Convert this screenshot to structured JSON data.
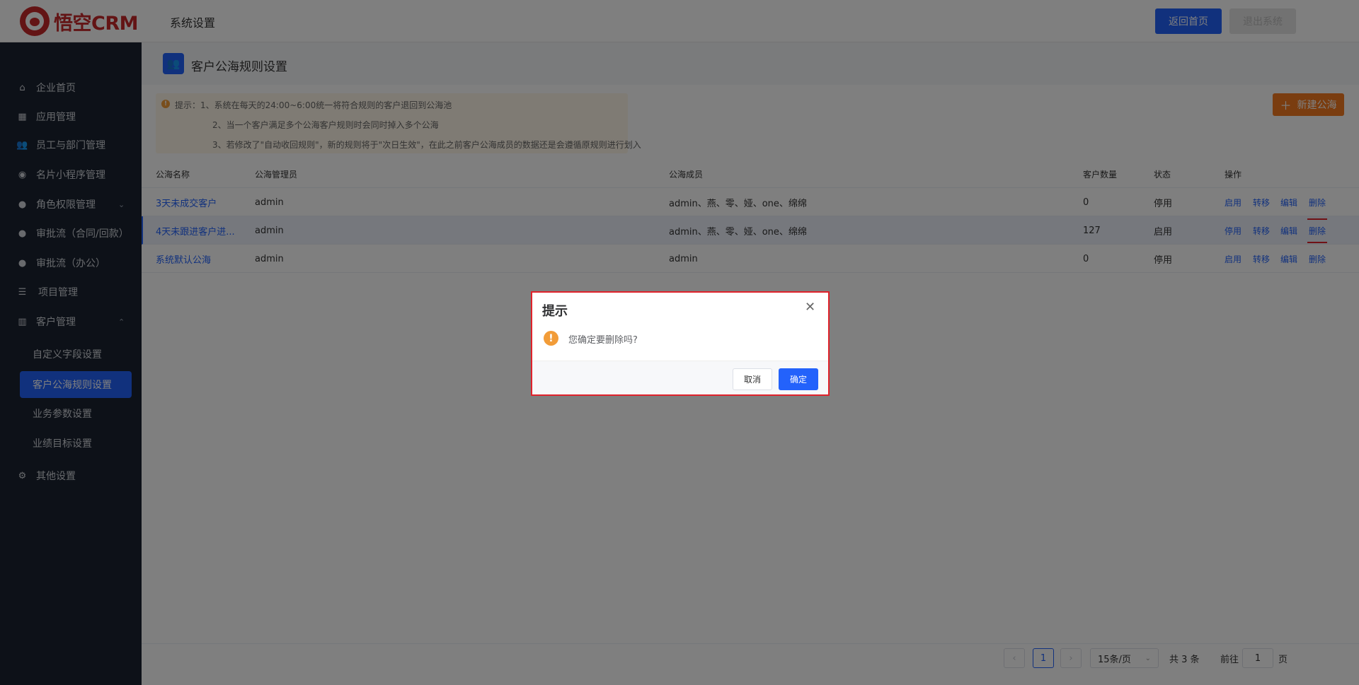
{
  "header": {
    "logo_text": "悟空CRM",
    "title": "系统设置",
    "home_button": "返回首页",
    "logout_button": "退出系统"
  },
  "sidebar": {
    "items": [
      {
        "label": "企业首页",
        "icon": "home-icon"
      },
      {
        "label": "应用管理",
        "icon": "grid-icon"
      },
      {
        "label": "员工与部门管理",
        "icon": "users-icon"
      },
      {
        "label": "名片小程序管理",
        "icon": "compass-icon"
      },
      {
        "label": "角色权限管理",
        "icon": "user-icon"
      },
      {
        "label": "审批流（合同/回款）",
        "icon": "user-icon"
      },
      {
        "label": "审批流（办公）",
        "icon": "user-icon"
      },
      {
        "label": "项目管理",
        "icon": "list-icon"
      },
      {
        "label": "客户管理",
        "icon": "building-icon"
      },
      {
        "label": "其他设置",
        "icon": "gear-icon"
      }
    ],
    "sub_items": [
      "自定义字段设置",
      "客户公海规则设置",
      "业务参数设置",
      "业绩目标设置"
    ]
  },
  "page": {
    "title": "客户公海规则设置",
    "new_button": "新建公海",
    "tips": [
      "提示：1、系统在每天的24:00~6:00统一将符合规则的客户退回到公海池",
      "2、当一个客户满足多个公海客户规则时会同时掉入多个公海",
      "3、若修改了\"自动收回规则\"，新的规则将于\"次日生效\"，在此之前客户公海成员的数据还是会遵循原规则进行划入"
    ]
  },
  "table": {
    "headers": [
      "公海名称",
      "公海管理员",
      "公海成员",
      "客户数量",
      "状态",
      "操作"
    ],
    "rows": [
      {
        "name": "3天未成交客户",
        "admin": "admin",
        "members": "admin、燕、零、娅、one、绵绵",
        "count": "0",
        "status": "停用",
        "ops": [
          "启用",
          "转移",
          "编辑",
          "删除"
        ]
      },
      {
        "name": "4天未跟进客户进...",
        "admin": "admin",
        "members": "admin、燕、零、娅、one、绵绵",
        "count": "127",
        "status": "启用",
        "ops": [
          "停用",
          "转移",
          "编辑",
          "删除"
        ]
      },
      {
        "name": "系统默认公海",
        "admin": "admin",
        "members": "admin",
        "count": "0",
        "status": "停用",
        "ops": [
          "启用",
          "转移",
          "编辑",
          "删除"
        ]
      }
    ]
  },
  "pagination": {
    "current_page": "1",
    "page_size": "15条/页",
    "total": "共 3 条",
    "goto_label": "前往",
    "goto_value": "1",
    "page_suffix": "页"
  },
  "dialog": {
    "title": "提示",
    "message": "您确定要删除吗?",
    "cancel": "取消",
    "confirm": "确定"
  }
}
